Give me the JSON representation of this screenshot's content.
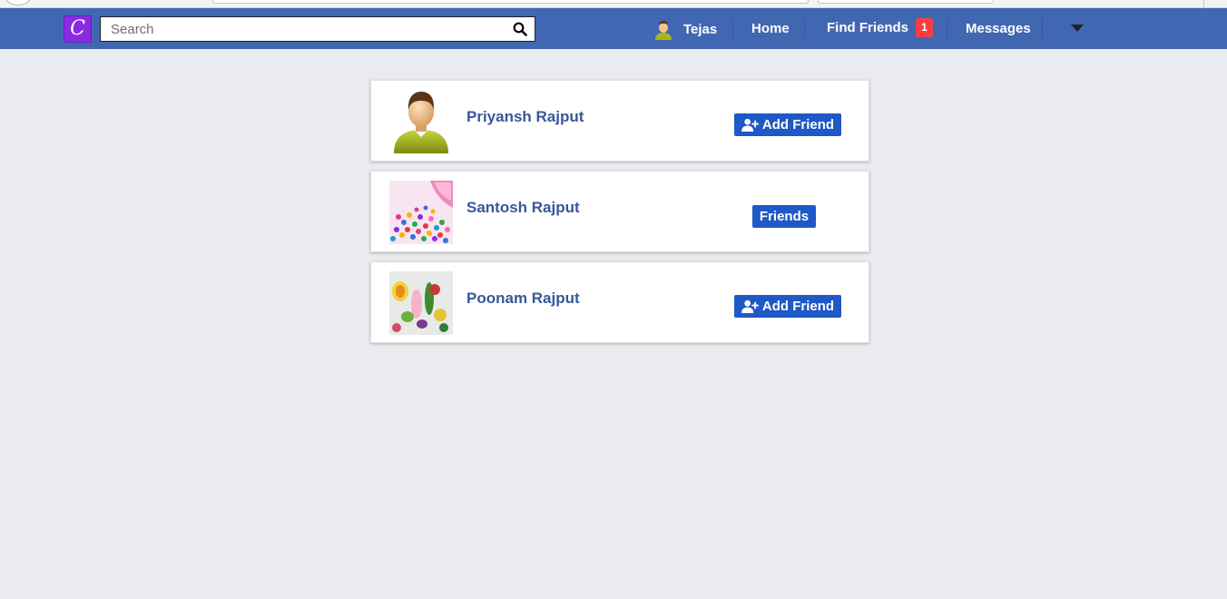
{
  "navbar": {
    "logo_letter": "C",
    "search_placeholder": "Search",
    "user_name": "Tejas",
    "home_label": "Home",
    "find_friends_label": "Find Friends",
    "find_friends_badge": "1",
    "messages_label": "Messages",
    "accent_color": "#4267b2",
    "logo_color": "#8a2be2",
    "badge_color": "#fa3e3e"
  },
  "people": [
    {
      "name": "Priyansh Rajput",
      "action_label": "Add Friend",
      "action_icon": "user-plus-icon",
      "avatar": "default-user-avatar"
    },
    {
      "name": "Santosh Rajput",
      "action_label": "Friends",
      "action_icon": "",
      "avatar": "colorful-candy-photo"
    },
    {
      "name": "Poonam Rajput",
      "action_label": "Add Friend",
      "action_icon": "user-plus-icon",
      "avatar": "fruit-food-photo"
    }
  ],
  "colors": {
    "page_background": "#e9ebee",
    "name_color": "#365899",
    "button_color": "#1f58c7"
  }
}
